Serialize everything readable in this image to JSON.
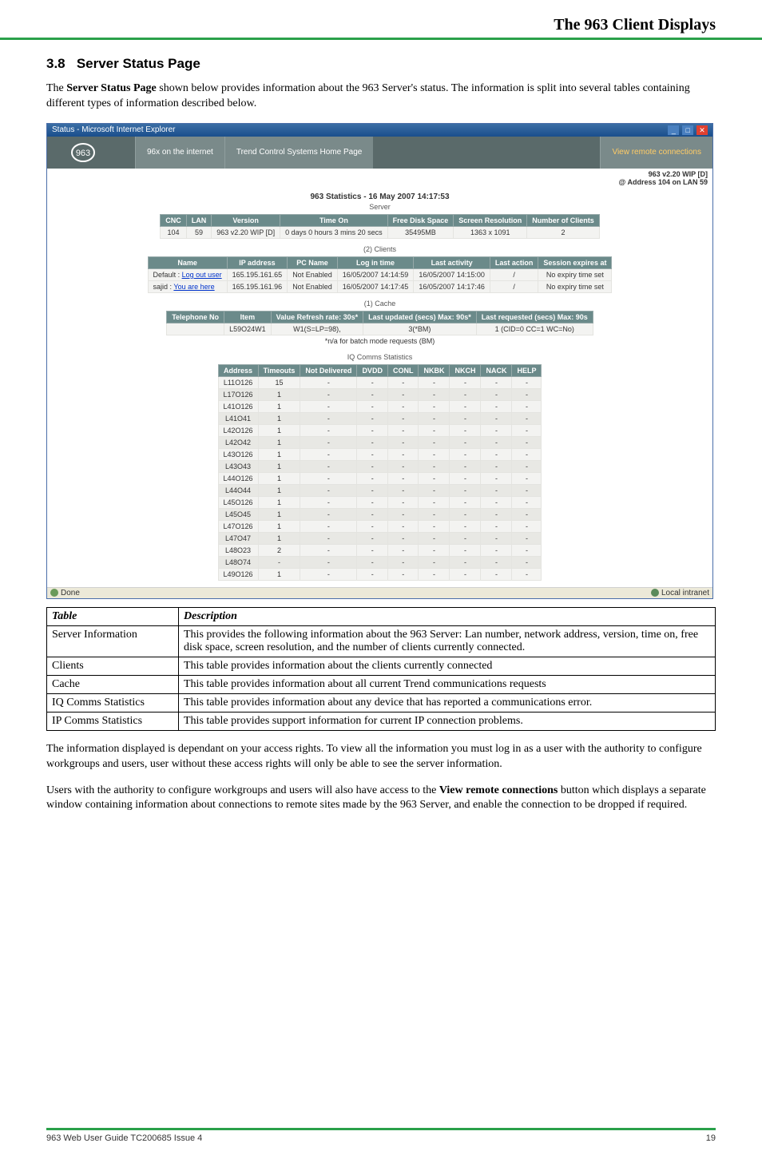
{
  "header": {
    "title": "The 963 Client Displays"
  },
  "section": {
    "number": "3.8",
    "title": "Server Status Page",
    "intro_pre": "The ",
    "intro_bold": "Server Status Page",
    "intro_post": " shown below provides information about the 963 Server's status. The information is split into several tables containing different types of information described below."
  },
  "screenshot": {
    "window_title": "Status - Microsoft Internet Explorer",
    "topbar": {
      "link_home": "96x on the internet",
      "link_center": "Trend Control Systems Home Page",
      "link_right": "View remote connections"
    },
    "sub_line1": "963 v2.20 WIP [D]",
    "sub_line2": "@ Address 104 on LAN 59",
    "stats_title": "963 Statistics - 16 May 2007 14:17:53",
    "server_label": "Server",
    "server_table": {
      "headers": [
        "CNC",
        "LAN",
        "Version",
        "Time On",
        "Free Disk Space",
        "Screen Resolution",
        "Number of Clients"
      ],
      "row": [
        "104",
        "59",
        "963 v2.20 WIP [D]",
        "0 days 0 hours 3 mins 20 secs",
        "35495MB",
        "1363 x 1091",
        "2"
      ]
    },
    "clients_label": "(2) Clients",
    "clients_table": {
      "headers": [
        "Name",
        "IP address",
        "PC Name",
        "Log in time",
        "Last activity",
        "Last action",
        "Session expires at"
      ],
      "rows": [
        [
          "Default : ",
          "Log out user",
          "165.195.161.65",
          "Not Enabled",
          "16/05/2007 14:14:59",
          "16/05/2007 14:15:00",
          "/",
          "No expiry time set"
        ],
        [
          "sajid : ",
          "You are here",
          "165.195.161.96",
          "Not Enabled",
          "16/05/2007 14:17:45",
          "16/05/2007 14:17:46",
          "/",
          "No expiry time set"
        ]
      ]
    },
    "cache_label": "(1) Cache",
    "cache_table": {
      "headers": [
        "Telephone No",
        "Item",
        "Value Refresh rate: 30s*",
        "Last updated (secs) Max: 90s*",
        "Last requested (secs) Max: 90s"
      ],
      "row": [
        "",
        "L59O24W1",
        "W1(S=LP=98),",
        "3(*BM)",
        "1 (CID=0 CC=1 WC=No)"
      ],
      "footnote": "*n/a for batch mode requests (BM)"
    },
    "iq_label": "IQ Comms Statistics",
    "iq_table": {
      "headers": [
        "Address",
        "Timeouts",
        "Not Delivered",
        "DVDD",
        "CONL",
        "NKBK",
        "NKCH",
        "NACK",
        "HELP"
      ],
      "rows": [
        [
          "L11O126",
          "15",
          "-",
          "-",
          "-",
          "-",
          "-",
          "-",
          "-"
        ],
        [
          "L17O126",
          "1",
          "-",
          "-",
          "-",
          "-",
          "-",
          "-",
          "-"
        ],
        [
          "L41O126",
          "1",
          "-",
          "-",
          "-",
          "-",
          "-",
          "-",
          "-"
        ],
        [
          "L41O41",
          "1",
          "-",
          "-",
          "-",
          "-",
          "-",
          "-",
          "-"
        ],
        [
          "L42O126",
          "1",
          "-",
          "-",
          "-",
          "-",
          "-",
          "-",
          "-"
        ],
        [
          "L42O42",
          "1",
          "-",
          "-",
          "-",
          "-",
          "-",
          "-",
          "-"
        ],
        [
          "L43O126",
          "1",
          "-",
          "-",
          "-",
          "-",
          "-",
          "-",
          "-"
        ],
        [
          "L43O43",
          "1",
          "-",
          "-",
          "-",
          "-",
          "-",
          "-",
          "-"
        ],
        [
          "L44O126",
          "1",
          "-",
          "-",
          "-",
          "-",
          "-",
          "-",
          "-"
        ],
        [
          "L44O44",
          "1",
          "-",
          "-",
          "-",
          "-",
          "-",
          "-",
          "-"
        ],
        [
          "L45O126",
          "1",
          "-",
          "-",
          "-",
          "-",
          "-",
          "-",
          "-"
        ],
        [
          "L45O45",
          "1",
          "-",
          "-",
          "-",
          "-",
          "-",
          "-",
          "-"
        ],
        [
          "L47O126",
          "1",
          "-",
          "-",
          "-",
          "-",
          "-",
          "-",
          "-"
        ],
        [
          "L47O47",
          "1",
          "-",
          "-",
          "-",
          "-",
          "-",
          "-",
          "-"
        ],
        [
          "L48O23",
          "2",
          "-",
          "-",
          "-",
          "-",
          "-",
          "-",
          "-"
        ],
        [
          "L48O74",
          "-",
          "-",
          "-",
          "-",
          "-",
          "-",
          "-",
          "-"
        ],
        [
          "L49O126",
          "1",
          "-",
          "-",
          "-",
          "-",
          "-",
          "-",
          "-"
        ]
      ]
    },
    "status_left": "Done",
    "status_right": "Local intranet"
  },
  "desc_table": {
    "h1": "Table",
    "h2": "Description",
    "rows": [
      [
        "Server Information",
        "This provides the following information about the 963 Server: Lan number, network address, version, time on, free disk space, screen resolution, and the number of clients currently connected."
      ],
      [
        "Clients",
        "This table provides information about the clients currently connected"
      ],
      [
        "Cache",
        "This table provides information about all current Trend communications requests"
      ],
      [
        "IQ Comms Statistics",
        "This table provides information about any device that has reported a communications error."
      ],
      [
        "IP Comms Statistics",
        "This table provides support information for current IP connection problems."
      ]
    ]
  },
  "para1": "The information displayed is dependant on your access rights. To view all the information you must log in as a user with the authority to configure workgroups and users, user without these access rights will only be able to see the server information.",
  "para2_pre": "Users with the authority to configure workgroups and users will also have access to the ",
  "para2_bold": "View remote connections",
  "para2_post": " button which displays a separate window containing information about connections to remote sites made by the 963 Server, and enable the connection to be dropped if required.",
  "footer": {
    "left": "963 Web User Guide TC200685 Issue 4",
    "right": "19"
  }
}
